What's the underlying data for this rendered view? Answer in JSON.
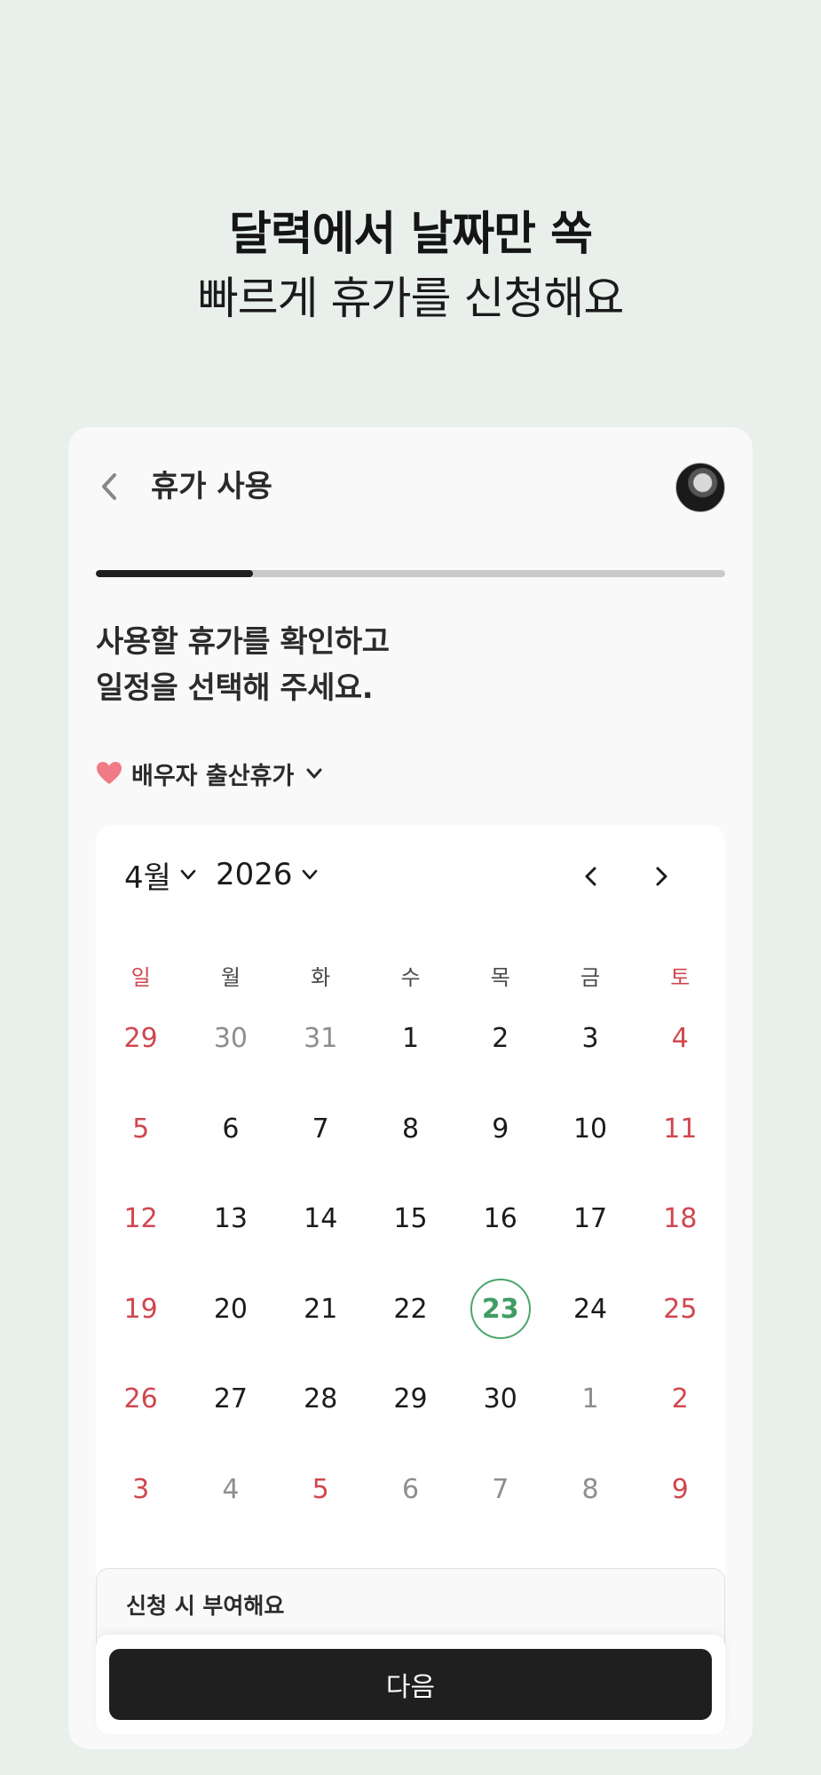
{
  "hero": {
    "line1": "달력에서 날짜만 쏙",
    "line2": "빠르게 휴가를 신청해요"
  },
  "header": {
    "title": "휴가 사용"
  },
  "progress": {
    "fraction": 0.25
  },
  "instruction": {
    "line1": "사용할 휴가를 확인하고",
    "line2": "일정을 선택해 주세요."
  },
  "leave_type": {
    "label": "배우자 출산휴가"
  },
  "calendar": {
    "month_label": "4월",
    "year_label": "2026",
    "weekdays": [
      "일",
      "월",
      "화",
      "수",
      "목",
      "금",
      "토"
    ],
    "weeks": [
      [
        "29",
        "30",
        "31",
        "1",
        "2",
        "3",
        "4"
      ],
      [
        "5",
        "6",
        "7",
        "8",
        "9",
        "10",
        "11"
      ],
      [
        "12",
        "13",
        "14",
        "15",
        "16",
        "17",
        "18"
      ],
      [
        "19",
        "20",
        "21",
        "22",
        "23",
        "24",
        "25"
      ],
      [
        "26",
        "27",
        "28",
        "29",
        "30",
        "1",
        "2"
      ],
      [
        "3",
        "4",
        "5",
        "6",
        "7",
        "8",
        "9"
      ]
    ],
    "selected_date": "23"
  },
  "grant_notice": {
    "text": "신청 시 부여해요"
  },
  "next_button": {
    "label": "다음"
  },
  "colors": {
    "accent_green": "#3f9c63",
    "holiday_red": "#d0474f",
    "button_dark": "#1f1f1f"
  }
}
